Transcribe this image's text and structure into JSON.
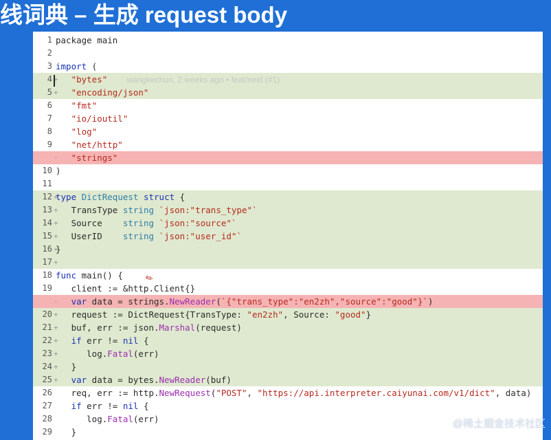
{
  "title": "线词典 – 生成 request body",
  "watermark": "@稀土掘金技术社区",
  "blame_text": "wangkechun, 2 weeks ago • feat/next (#1)",
  "colors": {
    "added_bg": "#dfe9cf",
    "removed_bg": "#f6b3b3",
    "keyword": "#1a33b5",
    "string": "#b52a1f"
  },
  "lines": [
    {
      "num": "1",
      "mark": "",
      "type": "",
      "html": "package main"
    },
    {
      "num": "2",
      "mark": "",
      "type": "",
      "html": ""
    },
    {
      "num": "3",
      "mark": "",
      "type": "",
      "html": "<span class=\"kw\">import</span> ("
    },
    {
      "num": "4",
      "mark": "+",
      "type": "added",
      "html": "   <span class=\"str\">\"bytes\"</span>"
    },
    {
      "num": "5",
      "mark": "+",
      "type": "added",
      "html": "   <span class=\"str\">\"encoding/json\"</span>"
    },
    {
      "num": "6",
      "mark": "",
      "type": "",
      "html": "   <span class=\"str\">\"fmt\"</span>"
    },
    {
      "num": "7",
      "mark": "",
      "type": "",
      "html": "   <span class=\"str\">\"io/ioutil\"</span>"
    },
    {
      "num": "8",
      "mark": "",
      "type": "",
      "html": "   <span class=\"str\">\"log\"</span>"
    },
    {
      "num": "9",
      "mark": "",
      "type": "",
      "html": "   <span class=\"str\">\"net/http\"</span>"
    },
    {
      "num": "",
      "mark": "-",
      "type": "removed",
      "html": "   <span class=\"str\">\"strings\"</span>"
    },
    {
      "num": "10",
      "mark": "",
      "type": "",
      "html": ")"
    },
    {
      "num": "11",
      "mark": "",
      "type": "",
      "html": ""
    },
    {
      "num": "12",
      "mark": "+",
      "type": "added",
      "html": "<span class=\"kw\">type</span> <span class=\"typ\">DictRequest</span> <span class=\"kw\">struct</span> {"
    },
    {
      "num": "13",
      "mark": "+",
      "type": "added",
      "html": "   TransType <span class=\"typ\">string</span> <span class=\"str\">`json:\"trans_type\"`</span>"
    },
    {
      "num": "14",
      "mark": "+",
      "type": "added",
      "html": "   Source    <span class=\"typ\">string</span> <span class=\"str\">`json:\"source\"`</span>"
    },
    {
      "num": "15",
      "mark": "+",
      "type": "added",
      "html": "   UserID    <span class=\"typ\">string</span> <span class=\"str\">`json:\"user_id\"`</span>"
    },
    {
      "num": "16",
      "mark": "+",
      "type": "added",
      "html": "}"
    },
    {
      "num": "17",
      "mark": "+",
      "type": "added",
      "html": ""
    },
    {
      "num": "18",
      "mark": "",
      "type": "",
      "html": "<span class=\"kw\">func</span> main() {"
    },
    {
      "num": "19",
      "mark": "",
      "type": "",
      "html": "   client := &amp;http.Client{}"
    },
    {
      "num": "",
      "mark": "-",
      "type": "removed",
      "html": "   <span class=\"kw\">var</span> data = strings.<span class=\"fn\">NewReader</span>(<span class=\"str\">`{\"trans_type\":\"en2zh\",\"source\":\"good\"}`</span>)"
    },
    {
      "num": "20",
      "mark": "+",
      "type": "added",
      "html": "   request := DictRequest{TransType: <span class=\"str\">\"en2zh\"</span>, Source: <span class=\"str\">\"good\"</span>}"
    },
    {
      "num": "21",
      "mark": "+",
      "type": "added",
      "html": "   buf, err := json.<span class=\"fn\">Marshal</span>(request)"
    },
    {
      "num": "22",
      "mark": "+",
      "type": "added",
      "html": "   <span class=\"kw\">if</span> err != <span class=\"kw\">nil</span> {"
    },
    {
      "num": "23",
      "mark": "+",
      "type": "added",
      "html": "      log.<span class=\"fn\">Fatal</span>(err)"
    },
    {
      "num": "24",
      "mark": "+",
      "type": "added",
      "html": "   }"
    },
    {
      "num": "25",
      "mark": "+",
      "type": "added",
      "html": "   <span class=\"kw\">var</span> data = bytes.<span class=\"fn\">NewReader</span>(buf)"
    },
    {
      "num": "26",
      "mark": "",
      "type": "",
      "html": "   req, err := http.<span class=\"fn\">NewRequest</span>(<span class=\"str\">\"POST\"</span>, <span class=\"str\">\"https://api.interpreter.caiyunai.com/v1/dict\"</span>, data)"
    },
    {
      "num": "27",
      "mark": "",
      "type": "",
      "html": "   <span class=\"kw\">if</span> err != <span class=\"kw\">nil</span> {"
    },
    {
      "num": "28",
      "mark": "",
      "type": "",
      "html": "      log.<span class=\"fn\">Fatal</span>(err)"
    },
    {
      "num": "29",
      "mark": "",
      "type": "",
      "html": "   }"
    }
  ]
}
